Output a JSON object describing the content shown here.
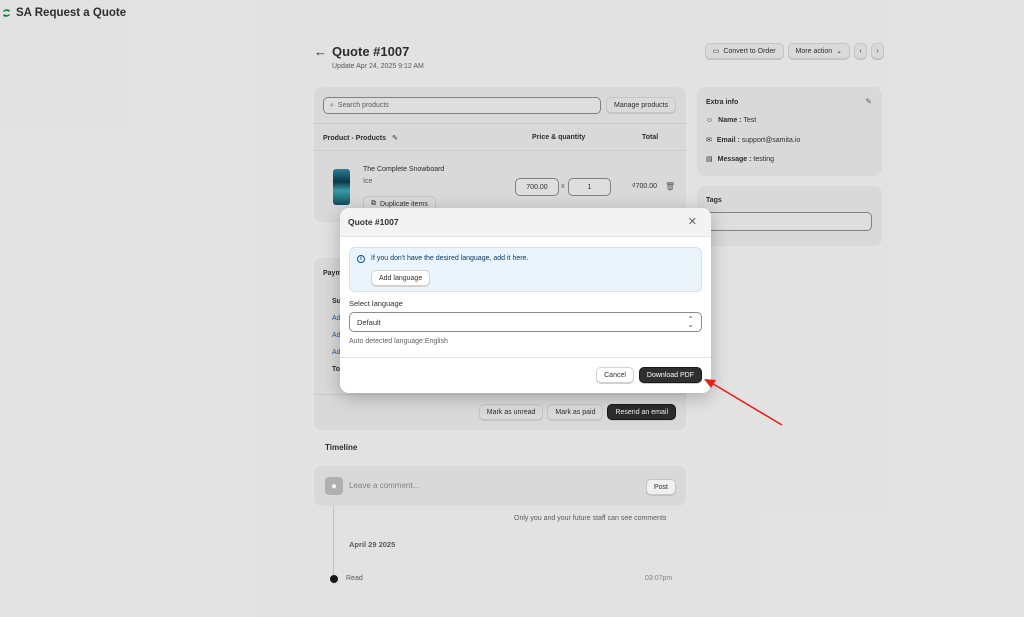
{
  "app": {
    "title": "SA Request a Quote",
    "logo_icon": "app-logo-icon"
  },
  "header": {
    "back_icon": "←",
    "quote_title": "Quote #1007",
    "updated": "Update Apr 24, 2025 9:12 AM",
    "convert_label": "Convert to Order",
    "more_action_label": "More action",
    "prev_icon": "‹",
    "next_icon": "›"
  },
  "products": {
    "search_placeholder": "Search products",
    "manage_label": "Manage products",
    "col_product": "Product - Products",
    "col_price": "Price & quantity",
    "col_total": "Total",
    "items": [
      {
        "name": "The Complete Snowboard",
        "variant": "Ice",
        "duplicate_label": "Duplicate items",
        "price": "700.00",
        "qty": "1",
        "times": "x",
        "total": "₫700.00"
      }
    ]
  },
  "extra_info": {
    "title": "Extra info",
    "rows": [
      {
        "label": "Name :",
        "value": " Test"
      },
      {
        "label": "Email :",
        "value": " support@samita.io"
      },
      {
        "label": "Message :",
        "value": " testing"
      }
    ]
  },
  "tags": {
    "title": "Tags"
  },
  "payment": {
    "title": "Paym",
    "rows": [
      "Su",
      "Ad",
      "Ad",
      "Ad",
      "To"
    ],
    "mark_unread": "Mark as unread",
    "mark_paid": "Mark as paid",
    "resend": "Resend an email"
  },
  "timeline": {
    "title": "Timeline",
    "comment_placeholder": "Leave a comment...",
    "post_label": "Post",
    "staff_note": "Only you and your future staff can see comments",
    "date": "April 29 2025",
    "event": "Read",
    "time": "03:07pm"
  },
  "modal": {
    "title": "Quote #1007",
    "close_icon": "✕",
    "info_text": "If you don't have the desired language, add it here.",
    "add_language_label": "Add language",
    "select_label": "Select language",
    "selected_value": "Default",
    "auto_detect": "Auto detected language:English",
    "cancel_label": "Cancel",
    "download_label": "Download PDF"
  },
  "colors": {
    "accent_dark": "#2f2f2f",
    "arrow": "#e8201a",
    "info_bg": "#eaf4fd"
  }
}
